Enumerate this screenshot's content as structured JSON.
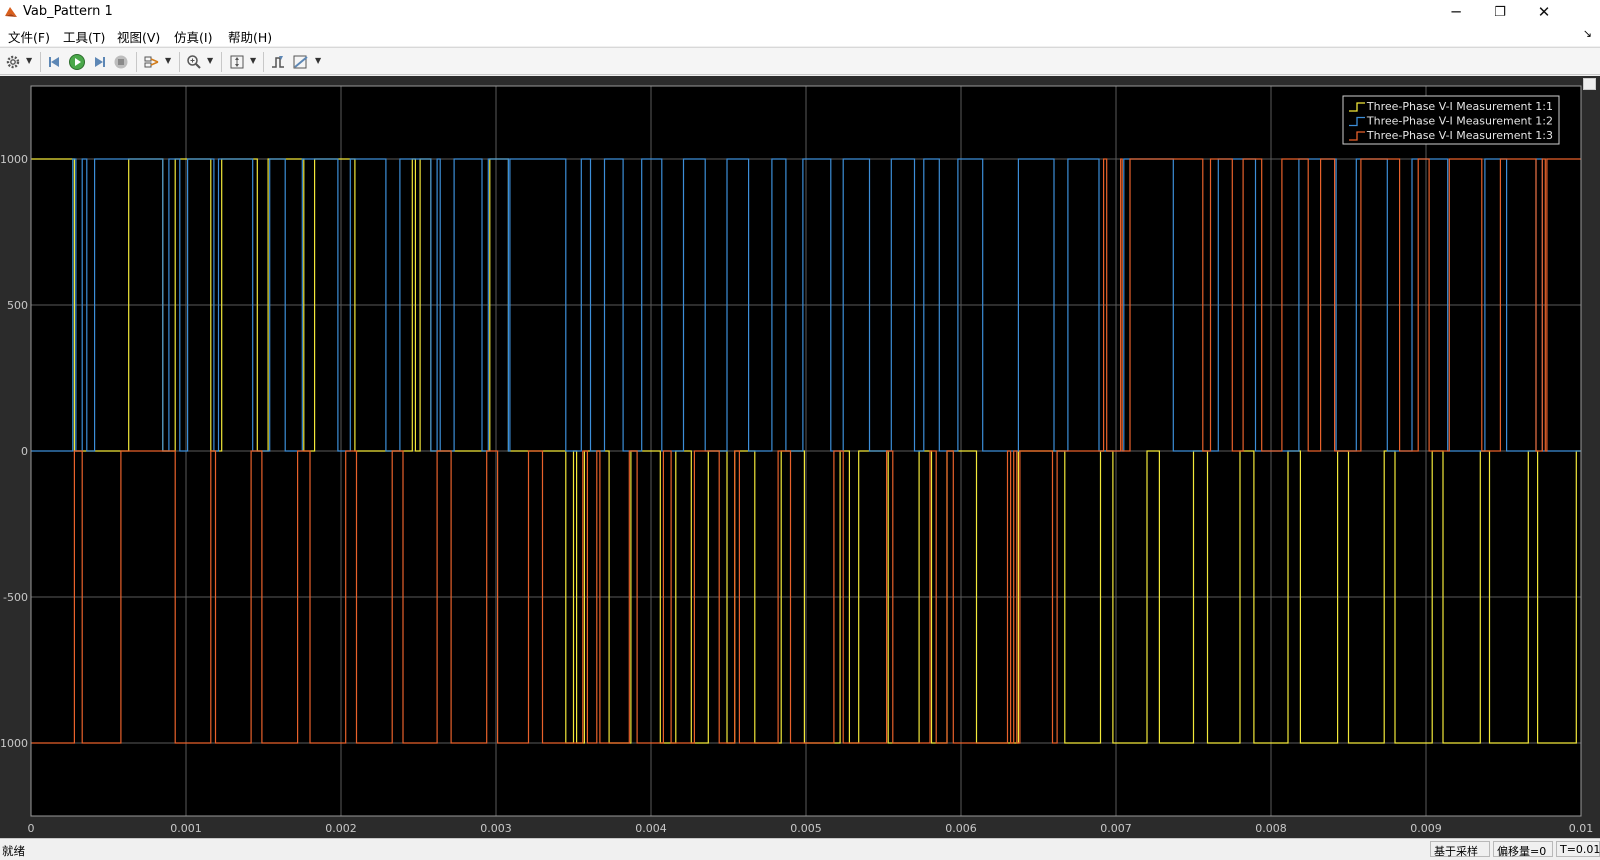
{
  "window": {
    "title": "Vab_Pattern 1",
    "minimize": "─",
    "restore": "❐",
    "close": "✕"
  },
  "menu": [
    {
      "label": "文件(F)"
    },
    {
      "label": "工具(T)"
    },
    {
      "label": "视图(V)"
    },
    {
      "label": "仿真(I)"
    },
    {
      "label": "帮助(H)"
    }
  ],
  "menu_corner_icon": "↘",
  "toolbar": {
    "icons": [
      "settings-gear-icon",
      "step-back-icon",
      "run-icon",
      "step-forward-icon",
      "stop-icon",
      "highlight-signal-icon",
      "zoom-icon",
      "scale-axes-icon",
      "trigger-icon",
      "measure-icon"
    ]
  },
  "status": {
    "left": "就绪",
    "sample": "基于采样",
    "offset": "偏移量=0",
    "time": "T=0.010"
  },
  "colors": {
    "series1": "#f2e83a",
    "series2": "#3c8ed8",
    "series3": "#e8612b",
    "axes_bg": "#000000",
    "figure_bg": "#2b2b2b",
    "grid": "#5a5a5a",
    "tick_text": "#c8c8c8"
  },
  "chart_data": {
    "type": "line",
    "x_ticks": [
      "0",
      "0.001",
      "0.002",
      "0.003",
      "0.004",
      "0.005",
      "0.006",
      "0.007",
      "0.008",
      "0.009",
      "0.01"
    ],
    "y_ticks": [
      "1000",
      "500",
      "0",
      "-500",
      "-1000"
    ],
    "xlim": [
      0,
      0.01
    ],
    "ylim": [
      -1250,
      1250
    ],
    "grid": true,
    "legend_position": "top-right",
    "series": [
      {
        "name": "Three-Phase V-I Measurement 1:1",
        "color": "#f2e83a",
        "transitions": [
          [
            0,
            1000
          ],
          [
            0.00028,
            0
          ],
          [
            0.00063,
            1000
          ],
          [
            0.00085,
            0
          ],
          [
            0.00093,
            1000
          ],
          [
            0.00116,
            0
          ],
          [
            0.00123,
            1000
          ],
          [
            0.00146,
            0
          ],
          [
            0.00153,
            1000
          ],
          [
            0.00176,
            0
          ],
          [
            0.00183,
            1000
          ],
          [
            0.00209,
            0
          ],
          [
            0.00246,
            1000
          ],
          [
            0.00248,
            0
          ],
          [
            0.00251,
            1000
          ],
          [
            0.00258,
            0
          ],
          [
            0.00296,
            1000
          ],
          [
            0.00308,
            0
          ],
          [
            0.00345,
            -1000
          ],
          [
            0.0035,
            0
          ],
          [
            0.00352,
            -1000
          ],
          [
            0.00357,
            0
          ],
          [
            0.00373,
            -1000
          ],
          [
            0.00387,
            0
          ],
          [
            0.00406,
            -1000
          ],
          [
            0.00416,
            0
          ],
          [
            0.00426,
            -1000
          ],
          [
            0.00437,
            0
          ],
          [
            0.00449,
            -1000
          ],
          [
            0.00454,
            0
          ],
          [
            0.00467,
            -1000
          ],
          [
            0.00484,
            0
          ],
          [
            0.00499,
            -1000
          ],
          [
            0.00522,
            0
          ],
          [
            0.00528,
            -1000
          ],
          [
            0.00534,
            0
          ],
          [
            0.00553,
            -1000
          ],
          [
            0.00573,
            0
          ],
          [
            0.00581,
            -1000
          ],
          [
            0.00591,
            0
          ],
          [
            0.0061,
            -1000
          ],
          [
            0.00637,
            0
          ],
          [
            0.00667,
            -1000
          ],
          [
            0.0069,
            0
          ],
          [
            0.00698,
            -1000
          ],
          [
            0.0072,
            0
          ],
          [
            0.00728,
            -1000
          ],
          [
            0.0075,
            0
          ],
          [
            0.00759,
            -1000
          ],
          [
            0.0078,
            0
          ],
          [
            0.00789,
            -1000
          ],
          [
            0.00811,
            0
          ],
          [
            0.00819,
            -1000
          ],
          [
            0.00843,
            0
          ],
          [
            0.0085,
            -1000
          ],
          [
            0.00873,
            0
          ],
          [
            0.0088,
            -1000
          ],
          [
            0.00904,
            0
          ],
          [
            0.00911,
            -1000
          ],
          [
            0.00935,
            0
          ],
          [
            0.00941,
            -1000
          ],
          [
            0.00966,
            0
          ],
          [
            0.00972,
            -1000
          ],
          [
            0.00997,
            0
          ],
          [
            0.01,
            0
          ]
        ]
      },
      {
        "name": "Three-Phase V-I Measurement 1:2",
        "color": "#3c8ed8",
        "transitions": [
          [
            0,
            0
          ],
          [
            0.00027,
            1000
          ],
          [
            0.00029,
            0
          ],
          [
            0.00033,
            1000
          ],
          [
            0.00036,
            0
          ],
          [
            0.00041,
            1000
          ],
          [
            0.00085,
            0
          ],
          [
            0.00089,
            1000
          ],
          [
            0.00096,
            0
          ],
          [
            0.00101,
            1000
          ],
          [
            0.00118,
            0
          ],
          [
            0.00121,
            1000
          ],
          [
            0.00143,
            0
          ],
          [
            0.00154,
            1000
          ],
          [
            0.00164,
            0
          ],
          [
            0.00175,
            1000
          ],
          [
            0.00198,
            0
          ],
          [
            0.00206,
            1000
          ],
          [
            0.00229,
            0
          ],
          [
            0.00238,
            1000
          ],
          [
            0.00258,
            0
          ],
          [
            0.00262,
            1000
          ],
          [
            0.00264,
            0
          ],
          [
            0.00273,
            1000
          ],
          [
            0.00291,
            0
          ],
          [
            0.00295,
            1000
          ],
          [
            0.00308,
            0
          ],
          [
            0.00309,
            1000
          ],
          [
            0.00345,
            0
          ],
          [
            0.00355,
            1000
          ],
          [
            0.00361,
            0
          ],
          [
            0.0037,
            1000
          ],
          [
            0.00382,
            0
          ],
          [
            0.00394,
            1000
          ],
          [
            0.00407,
            0
          ],
          [
            0.00421,
            1000
          ],
          [
            0.00435,
            0
          ],
          [
            0.00449,
            1000
          ],
          [
            0.00463,
            0
          ],
          [
            0.00478,
            1000
          ],
          [
            0.00487,
            0
          ],
          [
            0.00498,
            1000
          ],
          [
            0.00516,
            0
          ],
          [
            0.00524,
            1000
          ],
          [
            0.00541,
            0
          ],
          [
            0.00555,
            1000
          ],
          [
            0.0057,
            0
          ],
          [
            0.00576,
            1000
          ],
          [
            0.00586,
            0
          ],
          [
            0.00598,
            1000
          ],
          [
            0.00614,
            0
          ],
          [
            0.00637,
            1000
          ],
          [
            0.0066,
            0
          ],
          [
            0.00669,
            1000
          ],
          [
            0.00689,
            0
          ],
          [
            0.00705,
            1000
          ],
          [
            0.00737,
            0
          ],
          [
            0.00766,
            1000
          ],
          [
            0.0079,
            0
          ],
          [
            0.00818,
            1000
          ],
          [
            0.00842,
            0
          ],
          [
            0.00855,
            1000
          ],
          [
            0.00875,
            0
          ],
          [
            0.00891,
            1000
          ],
          [
            0.00914,
            0
          ],
          [
            0.00938,
            1000
          ],
          [
            0.00952,
            0
          ],
          [
            0.00971,
            1000
          ],
          [
            0.00975,
            0
          ],
          [
            0.01,
            0
          ]
        ]
      },
      {
        "name": "Three-Phase V-I Measurement 1:3",
        "color": "#e8612b",
        "transitions": [
          [
            0,
            -1000
          ],
          [
            0.00028,
            0
          ],
          [
            0.00033,
            -1000
          ],
          [
            0.00058,
            0
          ],
          [
            0.00093,
            -1000
          ],
          [
            0.00116,
            0
          ],
          [
            0.00119,
            -1000
          ],
          [
            0.00142,
            0
          ],
          [
            0.00149,
            -1000
          ],
          [
            0.00172,
            0
          ],
          [
            0.0018,
            -1000
          ],
          [
            0.00203,
            0
          ],
          [
            0.0021,
            -1000
          ],
          [
            0.00233,
            0
          ],
          [
            0.0024,
            -1000
          ],
          [
            0.00262,
            0
          ],
          [
            0.00271,
            -1000
          ],
          [
            0.00294,
            0
          ],
          [
            0.00301,
            -1000
          ],
          [
            0.00321,
            0
          ],
          [
            0.0033,
            -1000
          ],
          [
            0.00356,
            0
          ],
          [
            0.00359,
            -1000
          ],
          [
            0.00365,
            0
          ],
          [
            0.00367,
            -1000
          ],
          [
            0.00386,
            0
          ],
          [
            0.00391,
            -1000
          ],
          [
            0.00408,
            0
          ],
          [
            0.00413,
            -1000
          ],
          [
            0.00428,
            0
          ],
          [
            0.00444,
            -1000
          ],
          [
            0.00454,
            0
          ],
          [
            0.00457,
            -1000
          ],
          [
            0.00482,
            0
          ],
          [
            0.0049,
            -1000
          ],
          [
            0.00518,
            0
          ],
          [
            0.00524,
            -1000
          ],
          [
            0.00552,
            0
          ],
          [
            0.00556,
            -1000
          ],
          [
            0.0058,
            0
          ],
          [
            0.00584,
            -1000
          ],
          [
            0.00591,
            0
          ],
          [
            0.00595,
            -1000
          ],
          [
            0.0063,
            0
          ],
          [
            0.00632,
            -1000
          ],
          [
            0.00634,
            0
          ],
          [
            0.00636,
            -1000
          ],
          [
            0.00638,
            0
          ],
          [
            0.00659,
            -1000
          ],
          [
            0.00662,
            0
          ],
          [
            0.00692,
            1000
          ],
          [
            0.00694,
            0
          ],
          [
            0.00703,
            1000
          ],
          [
            0.00704,
            0
          ],
          [
            0.00709,
            1000
          ],
          [
            0.00756,
            0
          ],
          [
            0.00761,
            1000
          ],
          [
            0.00775,
            0
          ],
          [
            0.00782,
            1000
          ],
          [
            0.00794,
            0
          ],
          [
            0.00807,
            1000
          ],
          [
            0.00824,
            0
          ],
          [
            0.00832,
            1000
          ],
          [
            0.00841,
            0
          ],
          [
            0.00858,
            1000
          ],
          [
            0.00883,
            0
          ],
          [
            0.00895,
            1000
          ],
          [
            0.00902,
            0
          ],
          [
            0.00915,
            1000
          ],
          [
            0.00936,
            0
          ],
          [
            0.00948,
            1000
          ],
          [
            0.00971,
            0
          ],
          [
            0.00975,
            1000
          ],
          [
            0.00977,
            0
          ],
          [
            0.00978,
            1000
          ],
          [
            0.01,
            1000
          ]
        ]
      }
    ]
  }
}
